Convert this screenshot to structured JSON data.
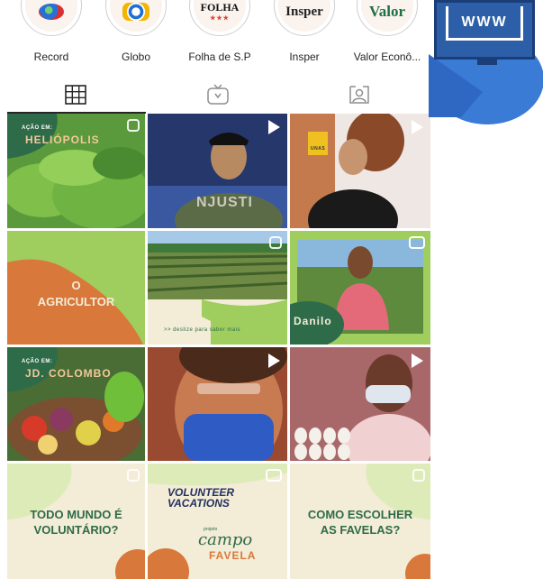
{
  "highlights": [
    {
      "label": "Record",
      "logo": "record-logo"
    },
    {
      "label": "Globo",
      "logo": "globo-logo"
    },
    {
      "label": "Folha de S.P",
      "logo_text": "FOLHA",
      "logo_sub": "★★★"
    },
    {
      "label": "Insper",
      "logo_text": "Insper"
    },
    {
      "label": "Valor Econô...",
      "logo_text": "Valor"
    }
  ],
  "tabs": [
    {
      "name": "grid",
      "icon": "grid-icon",
      "active": true
    },
    {
      "name": "igtv",
      "icon": "tv-icon",
      "active": false
    },
    {
      "name": "tagged",
      "icon": "tagged-person-icon",
      "active": false
    }
  ],
  "side": {
    "monitor_text": "WWW"
  },
  "posts": [
    {
      "kicker": "AÇÃO EM:",
      "title": "HELIÓPOLIS"
    },
    {
      "shirt": "NJUSTI"
    },
    {
      "sign": "UNAS"
    },
    {
      "title_line1": "O",
      "title_line2": "AGRICULTOR"
    },
    {
      "caption": ">> deslize para saber mais"
    },
    {
      "name": "Danilo"
    },
    {
      "kicker": "AÇÃO EM:",
      "title": "JD. COLOMBO"
    },
    {},
    {},
    {
      "line1": "TODO MUNDO É",
      "line2": "VOLUNTÁRIO?"
    },
    {
      "line1": "VOLUNTEER",
      "line2": "VACATIONS",
      "script_top": "projeto",
      "script": "campo",
      "script2": "FAVELA"
    },
    {
      "line1": "COMO ESCOLHER",
      "line2": "AS FAVELAS?"
    }
  ],
  "colors": {
    "accent_green": "#2e6b49",
    "cream": "#f3ecd6",
    "orange": "#d8783a",
    "light_green": "#9ccf5a"
  }
}
